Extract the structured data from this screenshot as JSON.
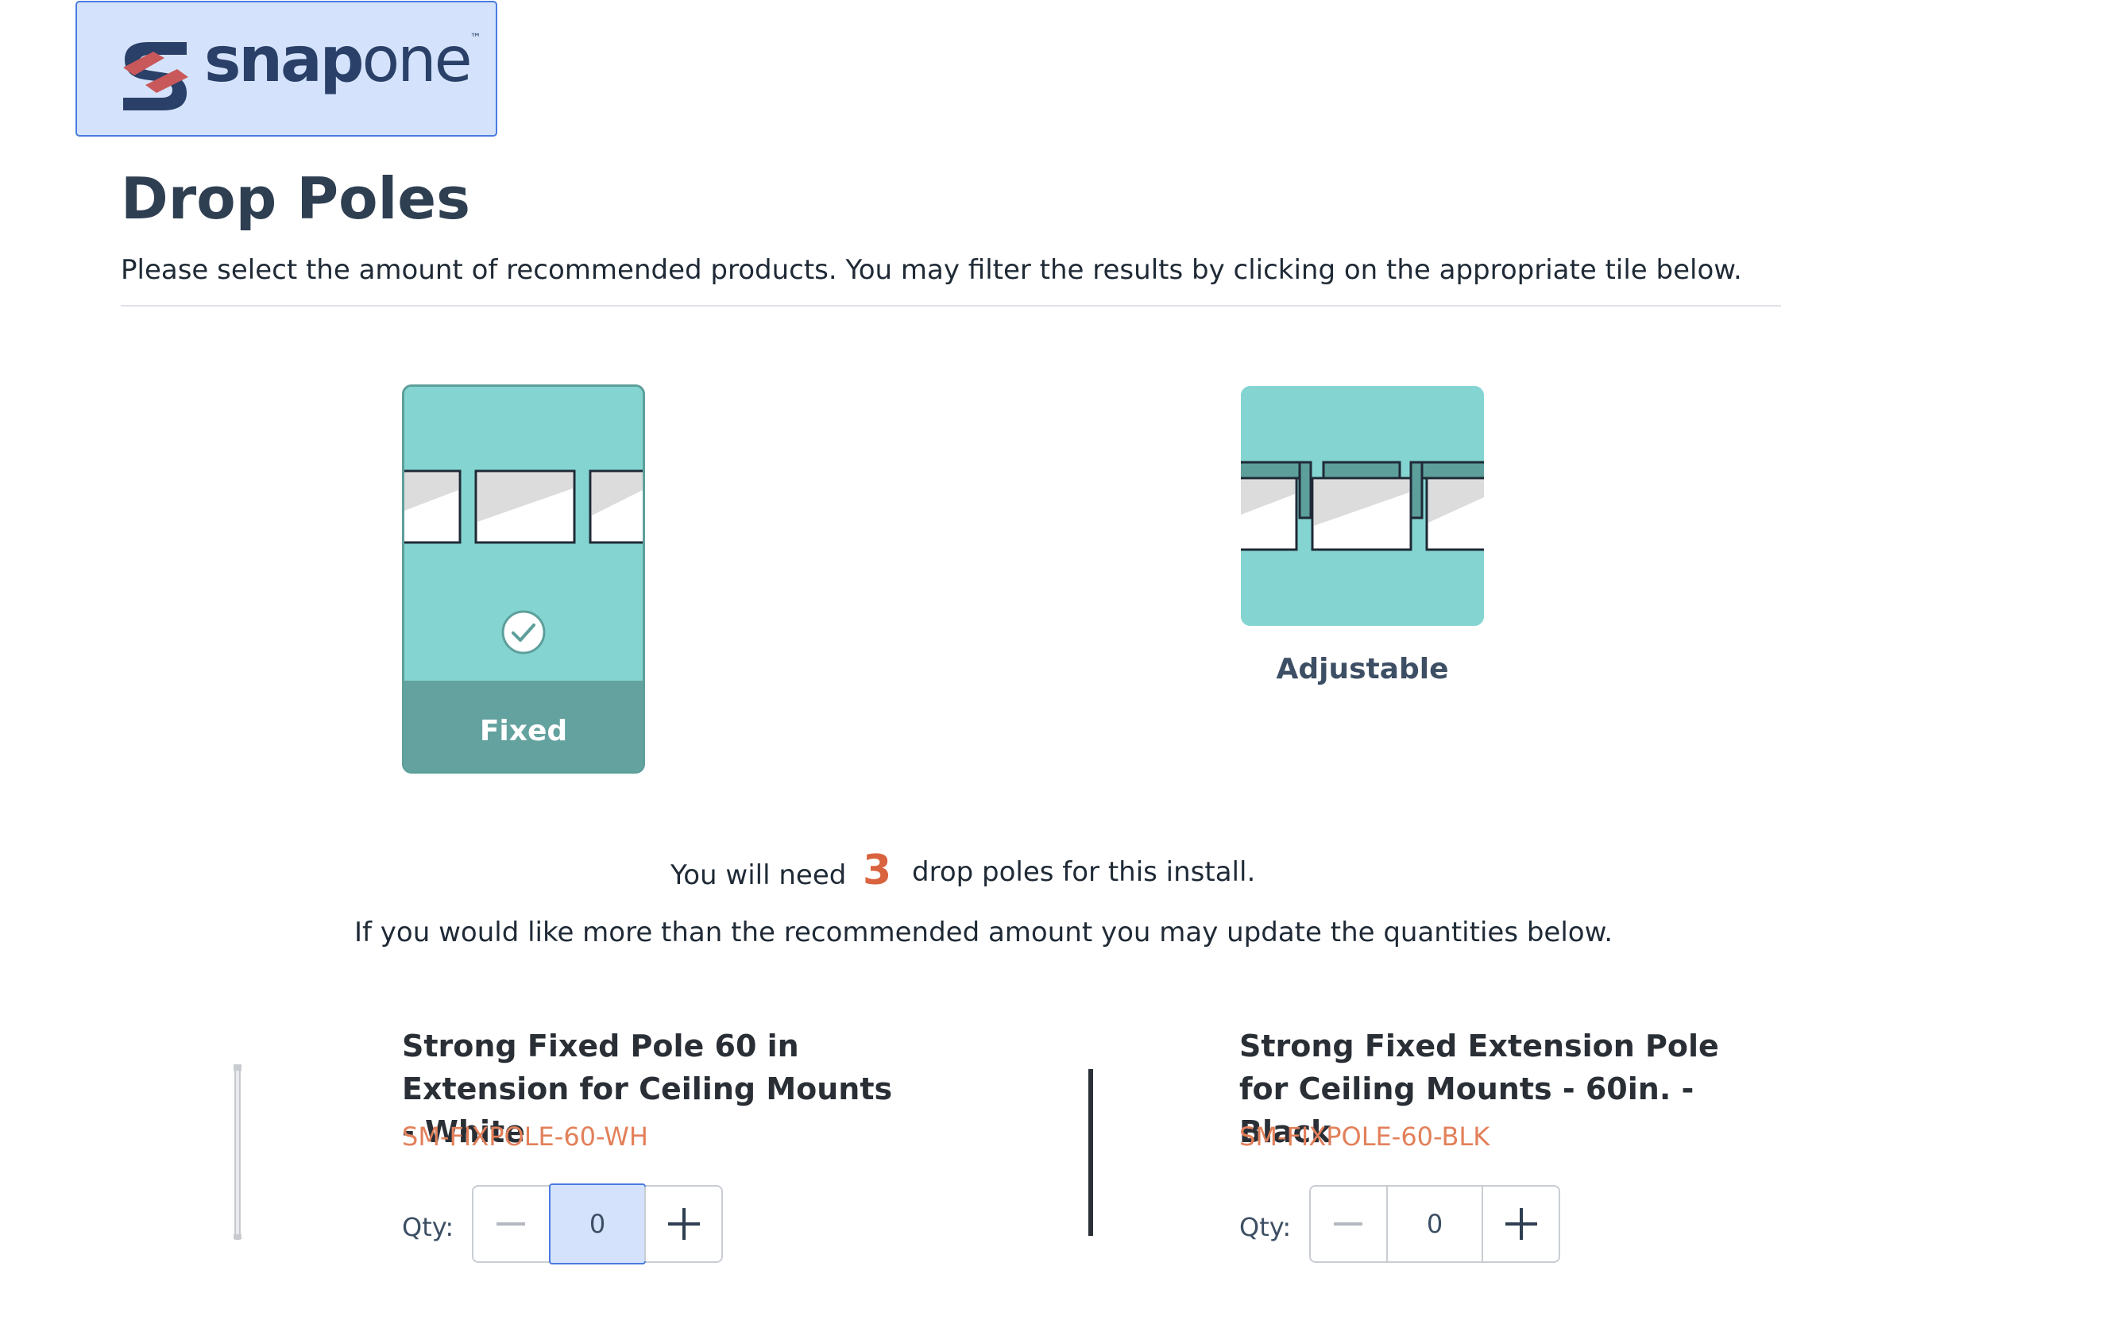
{
  "logo": {
    "word_bold": "snap",
    "word_light": "one",
    "trademark": "™",
    "icon": "snap-one-logo-icon"
  },
  "page": {
    "title": "Drop Poles",
    "subtitle": "Please select the amount of recommended products. You may filter the results by clicking on the appropriate tile below."
  },
  "tiles": [
    {
      "label": "Fixed",
      "selected": true,
      "icon": "check-circle-icon"
    },
    {
      "label": "Adjustable",
      "selected": false
    }
  ],
  "recommendation": {
    "prefix": "You will need",
    "count": "3",
    "suffix": "drop poles for this install.",
    "note": "If you would like more than the recommended amount you may update the quantities below."
  },
  "products": [
    {
      "name": "Strong Fixed Pole 60 in Extension for Ceiling Mounts - White",
      "sku": "SM-FIXPOLE-60-WH",
      "qty_label": "Qty:",
      "qty": "0",
      "pole_color": "#c8ccd1"
    },
    {
      "name": "Strong Fixed Extension Pole for Ceiling Mounts - 60in. - Black",
      "sku": "SM-FIXPOLE-60-BLK",
      "qty_label": "Qty:",
      "qty": "0",
      "pole_color": "#2b2f36"
    }
  ],
  "colors": {
    "accent_orange": "#d9633f",
    "sku_orange": "#e2805a",
    "tile_teal": "#84d5d2",
    "tile_teal_dark": "#63a29f",
    "focus_blue": "#4a7be0"
  }
}
